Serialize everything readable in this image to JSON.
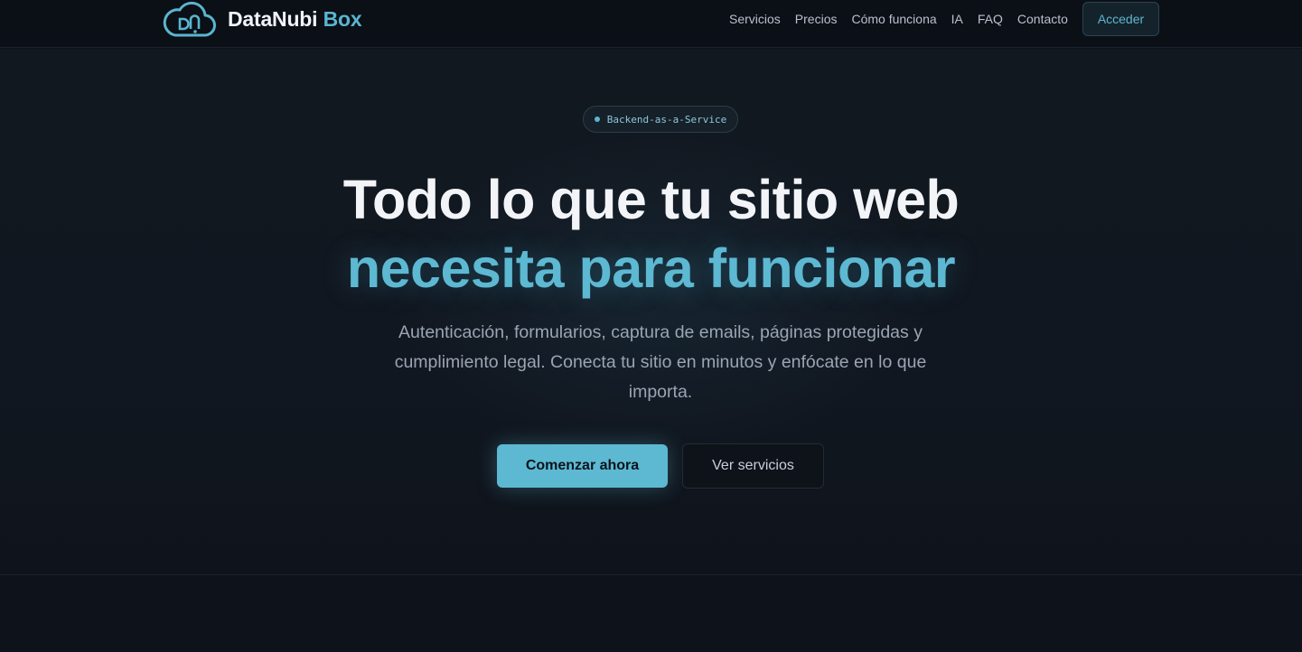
{
  "brand": {
    "name": "DataNubi",
    "accent": "Box",
    "logo_icon": "cloud-icon"
  },
  "nav": {
    "links": [
      "Servicios",
      "Precios",
      "Cómo funciona",
      "IA",
      "FAQ",
      "Contacto"
    ],
    "login_label": "Acceder"
  },
  "hero": {
    "badge": "Backend-as-a-Service",
    "title_line1": "Todo lo que tu sitio web",
    "title_line2": "necesita para funcionar",
    "subtitle": "Autenticación, formularios, captura de emails, páginas protegidas y cumplimiento legal. Conecta tu sitio en minutos y enfócate en lo que importa.",
    "cta_primary": "Comenzar ahora",
    "cta_secondary": "Ver servicios"
  },
  "colors": {
    "accent": "#5db8d2",
    "background": "#0d121a",
    "text": "#f2f4f8",
    "muted": "#9aa5b3"
  }
}
